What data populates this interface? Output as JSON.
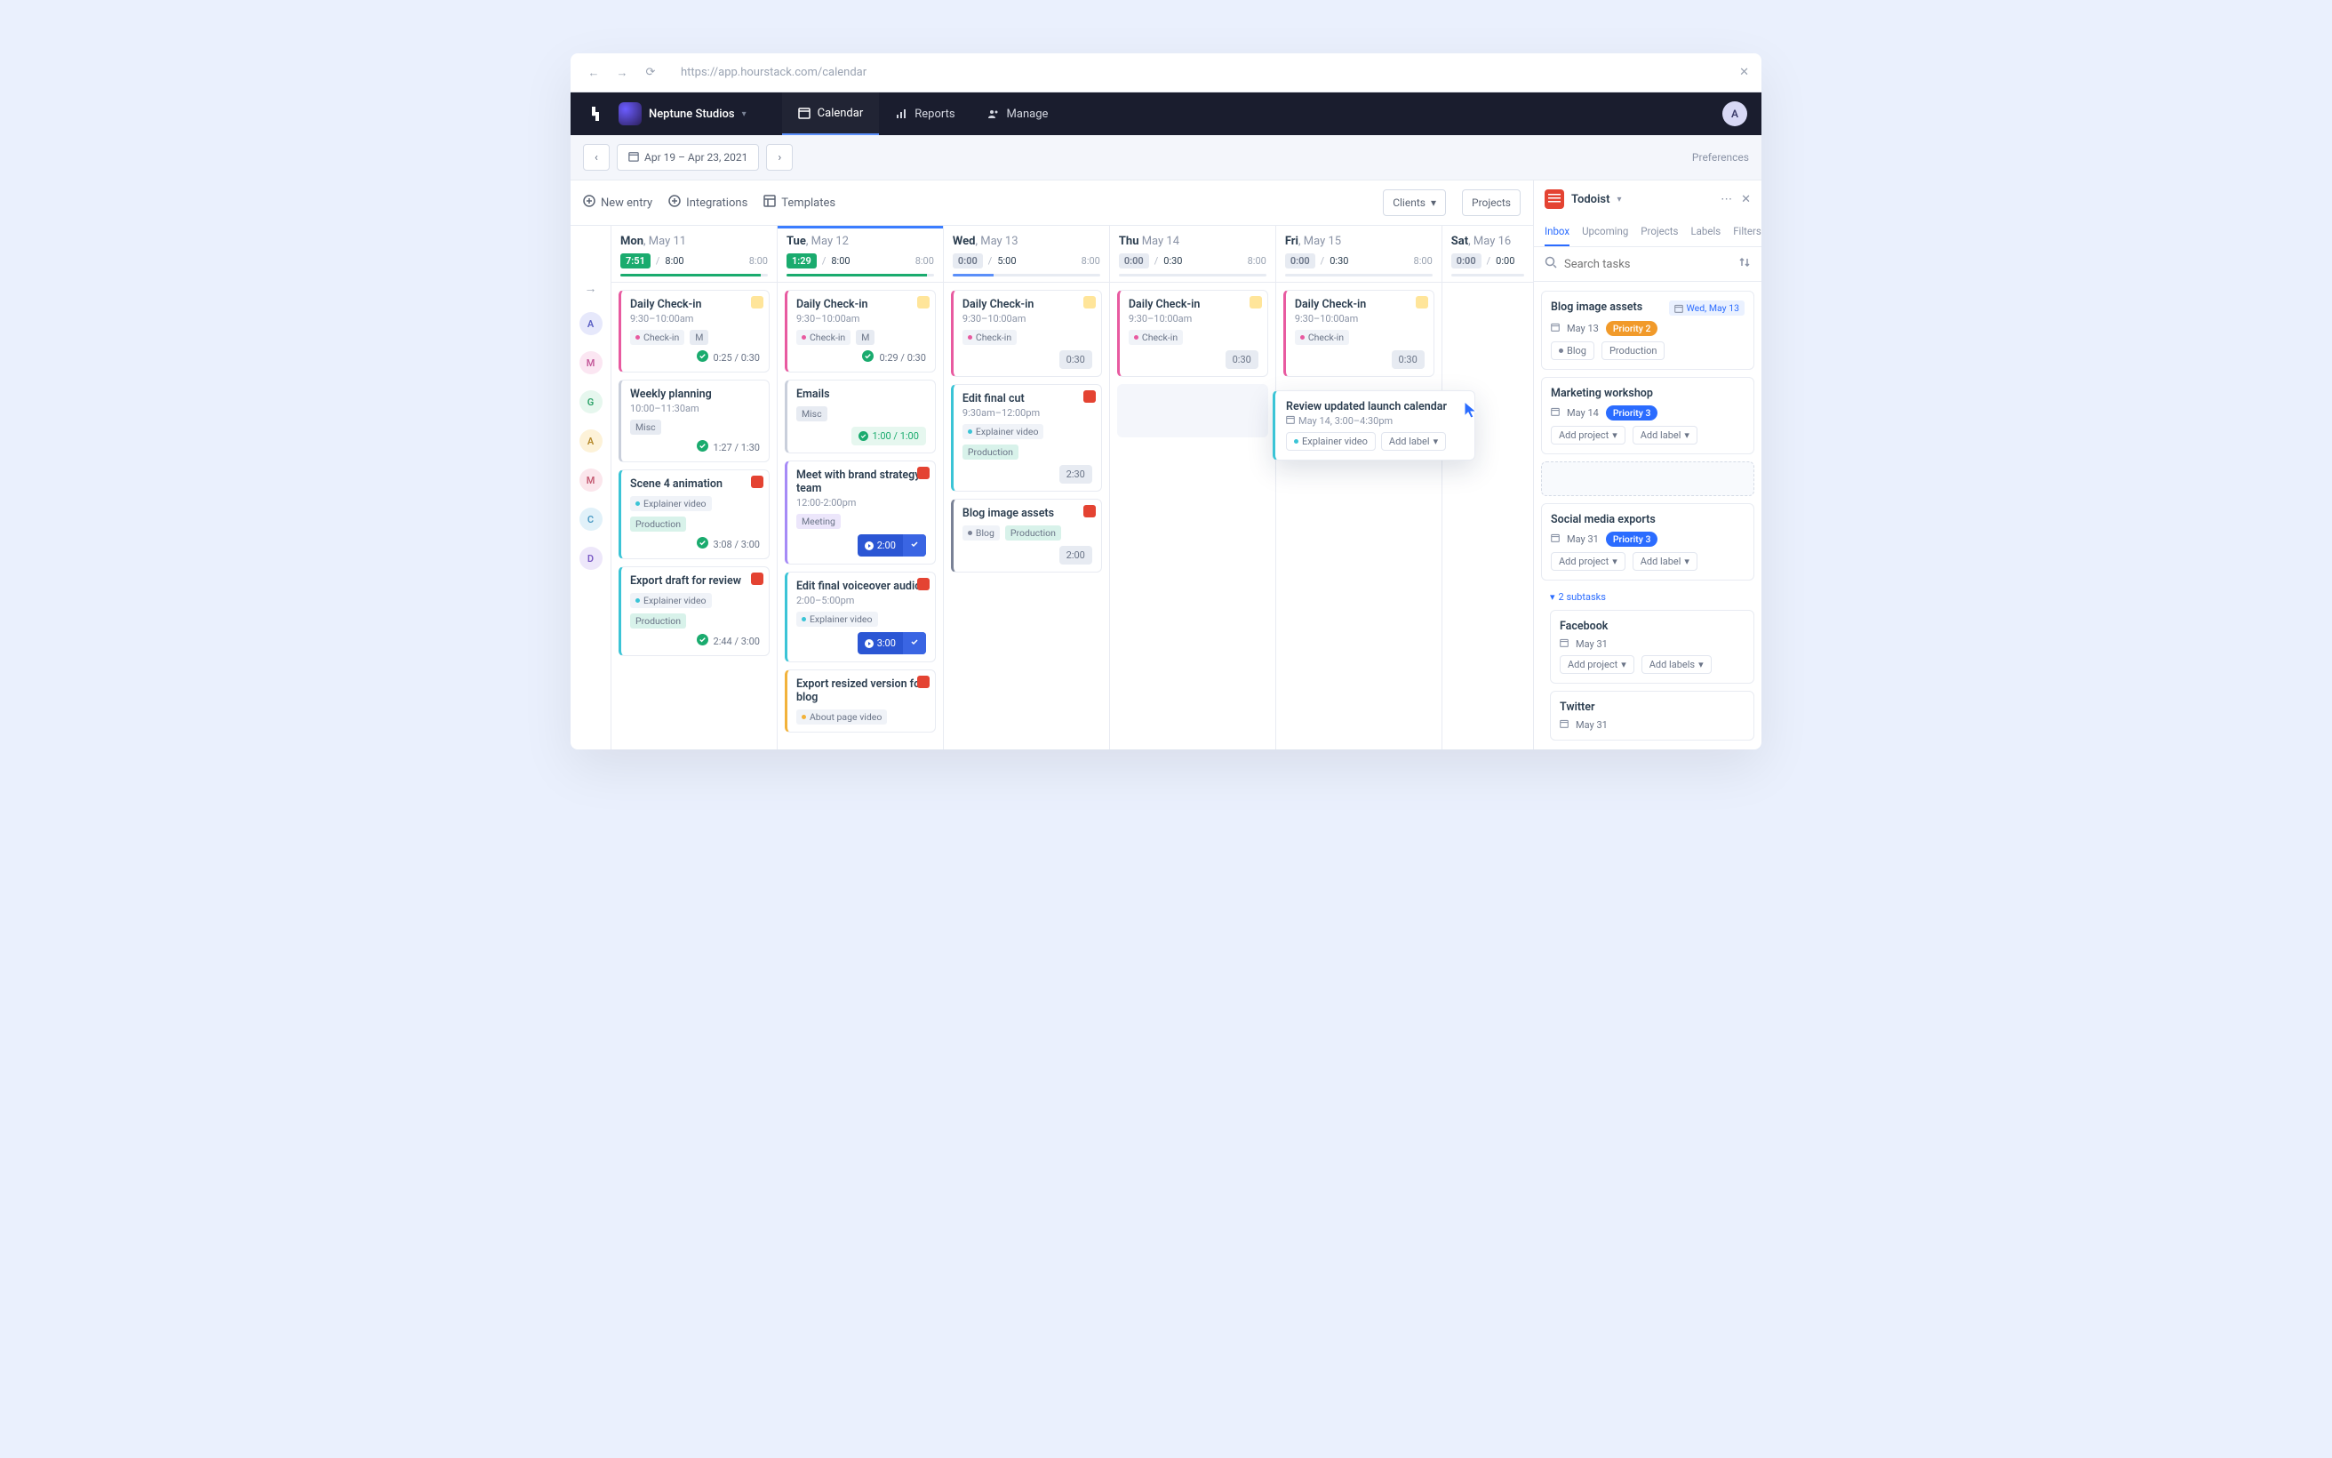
{
  "browser": {
    "url": "https://app.hourstack.com/calendar"
  },
  "topnav": {
    "workspace": "Neptune Studios",
    "items": [
      "Calendar",
      "Reports",
      "Manage"
    ],
    "avatar": "A"
  },
  "subbar": {
    "date_range": "Apr 19 – Apr 23, 2021",
    "preferences": "Preferences"
  },
  "toolbar": {
    "new_entry": "New entry",
    "integrations": "Integrations",
    "templates": "Templates",
    "clients": "Clients",
    "projects": "Projects"
  },
  "rail_users": [
    {
      "initial": "A",
      "bg": "#e6e8fb",
      "fg": "#5a5fc4"
    },
    {
      "initial": "M",
      "bg": "#fbe6f2",
      "fg": "#c45a9a"
    },
    {
      "initial": "G",
      "bg": "#e6f7ee",
      "fg": "#2fa36b"
    },
    {
      "initial": "A",
      "bg": "#fdf2d8",
      "fg": "#b5892b"
    },
    {
      "initial": "M",
      "bg": "#fbe6ec",
      "fg": "#c45a72"
    },
    {
      "initial": "C",
      "bg": "#e1f1f9",
      "fg": "#4a9ac4"
    },
    {
      "initial": "D",
      "bg": "#ede7fa",
      "fg": "#7a5ac4"
    }
  ],
  "columns": [
    {
      "day_short": "Mon",
      "day_rest": ", May 11",
      "badge": "7:51",
      "badge_class": "green",
      "planned": "8:00",
      "alt": "8:00",
      "bar": "bar-green",
      "cards": [
        {
          "accent": "#e85aa0",
          "title": "Daily Check-in",
          "sub": "9:30–10:00am",
          "badgeColor": "#ffe59a",
          "chips": [
            {
              "dot": "#e85aa0",
              "label": "Check-in"
            },
            {
              "label": "M",
              "bg": "#e7ebf2"
            }
          ],
          "foot": {
            "type": "done",
            "text": "0:25 / 0:30"
          }
        },
        {
          "accent": "#c9cfdb",
          "title": "Weekly planning",
          "sub": "10:00–11:30am",
          "chips": [
            {
              "label": "Misc",
              "bg": "#e7ebf2"
            }
          ],
          "foot": {
            "type": "done",
            "text": "1:27 / 1:30"
          }
        },
        {
          "accent": "#3bc4d6",
          "title": "Scene 4 animation",
          "badgeColor": "#e44332",
          "chips": [
            {
              "dot": "#3bc4d6",
              "label": "Explainer video"
            },
            {
              "label": "Production",
              "bg": "#d8f2ea"
            }
          ],
          "foot": {
            "type": "done",
            "text": "3:08 / 3:00"
          }
        },
        {
          "accent": "#3bc4d6",
          "title": "Export draft for review",
          "badgeColor": "#e44332",
          "chips": [
            {
              "dot": "#3bc4d6",
              "label": "Explainer video"
            },
            {
              "label": "Production",
              "bg": "#d8f2ea"
            }
          ],
          "foot": {
            "type": "done",
            "text": "2:44 / 3:00"
          }
        }
      ]
    },
    {
      "day_short": "Tue",
      "day_rest": ", May 12",
      "active": true,
      "badge": "1:29",
      "badge_class": "green",
      "planned": "8:00",
      "alt": "8:00",
      "bar": "bar-green",
      "cards": [
        {
          "accent": "#e85aa0",
          "title": "Daily Check-in",
          "sub": "9:30–10:00am",
          "badgeColor": "#ffe59a",
          "chips": [
            {
              "dot": "#e85aa0",
              "label": "Check-in"
            },
            {
              "label": "M",
              "bg": "#e7ebf2"
            }
          ],
          "foot": {
            "type": "done",
            "text": "0:29 / 0:30"
          }
        },
        {
          "accent": "#c9cfdb",
          "title": "Emails",
          "chips": [
            {
              "label": "Misc",
              "bg": "#e7ebf2"
            }
          ],
          "foot": {
            "type": "greenpill",
            "text": "1:00 / 1:00"
          }
        },
        {
          "accent": "#a68af6",
          "title": "Meet with brand strategy team",
          "sub": "12:00-2:00pm",
          "badgeColor": "#e44332",
          "chips": [
            {
              "label": "Meeting",
              "bg": "#ece6fb"
            }
          ],
          "foot": {
            "type": "play",
            "text": "2:00"
          }
        },
        {
          "accent": "#3bc4d6",
          "title": "Edit final voiceover audio",
          "sub": "2:00–5:00pm",
          "badgeColor": "#e44332",
          "chips": [
            {
              "dot": "#3bc4d6",
              "label": "Explainer video"
            }
          ],
          "foot": {
            "type": "play",
            "text": "3:00"
          }
        },
        {
          "accent": "#f2b23a",
          "title": "Export resized version for blog",
          "badgeColor": "#e44332",
          "chips": [
            {
              "dot": "#f2b23a",
              "label": "About page video"
            }
          ]
        }
      ]
    },
    {
      "day_short": "Wed",
      "day_rest": ", May 13",
      "badge": "0:00",
      "badge_class": "grey",
      "planned": "5:00",
      "alt": "8:00",
      "bar": "bar-blue",
      "cards": [
        {
          "accent": "#e85aa0",
          "title": "Daily Check-in",
          "sub": "9:30–10:00am",
          "badgeColor": "#ffe59a",
          "chips": [
            {
              "dot": "#e85aa0",
              "label": "Check-in"
            }
          ],
          "foot": {
            "type": "chip",
            "text": "0:30"
          }
        },
        {
          "accent": "#3bc4d6",
          "title": "Edit final cut",
          "sub": "9:30am–12:00pm",
          "badgeColor": "#e44332",
          "chips": [
            {
              "dot": "#3bc4d6",
              "label": "Explainer video"
            },
            {
              "label": "Production",
              "bg": "#d8f2ea"
            }
          ],
          "foot": {
            "type": "chip",
            "text": "2:30"
          }
        },
        {
          "accent": "#7a8296",
          "title": "Blog image assets",
          "badgeColor": "#e44332",
          "chips": [
            {
              "dot": "#7a8296",
              "label": "Blog"
            },
            {
              "label": "Production",
              "bg": "#d8f2ea"
            }
          ],
          "foot": {
            "type": "chip",
            "text": "2:00"
          }
        }
      ]
    },
    {
      "day_short": "Thu",
      "day_rest": " May 14",
      "badge": "0:00",
      "badge_class": "grey",
      "planned": "0:30",
      "alt": "8:00",
      "bar": "bar-grey",
      "cards": [
        {
          "accent": "#e85aa0",
          "title": "Daily Check-in",
          "sub": "9:30–10:00am",
          "badgeColor": "#ffe59a",
          "chips": [
            {
              "dot": "#e85aa0",
              "label": "Check-in"
            }
          ],
          "foot": {
            "type": "chip",
            "text": "0:30"
          }
        },
        {
          "placeholder": true
        }
      ]
    },
    {
      "day_short": "Fri",
      "day_rest": ", May 15",
      "badge": "0:00",
      "badge_class": "grey",
      "planned": "0:30",
      "alt": "8:00",
      "bar": "bar-grey",
      "cards": [
        {
          "accent": "#e85aa0",
          "title": "Daily Check-in",
          "sub": "9:30–10:00am",
          "badgeColor": "#ffe59a",
          "chips": [
            {
              "dot": "#e85aa0",
              "label": "Check-in"
            }
          ],
          "foot": {
            "type": "chip",
            "text": "0:30"
          }
        }
      ]
    },
    {
      "day_short": "Sat",
      "day_rest": ", May 16",
      "badge": "0:00",
      "badge_class": "grey",
      "planned": "0:00",
      "bar": "bar-grey",
      "cards": []
    }
  ],
  "dragged": {
    "title": "Review updated launch calendar",
    "sub": "May 14, 3:00–4:30pm",
    "chip_label": "Explainer video",
    "chip_dot": "#3bc4d6",
    "add_label": "Add label"
  },
  "todoist": {
    "title": "Todoist",
    "tabs": [
      "Inbox",
      "Upcoming",
      "Projects",
      "Labels",
      "Filters"
    ],
    "search_placeholder": "Search tasks",
    "tasks": [
      {
        "title": "Blog image assets",
        "date": "May 13",
        "priority": "Priority 2",
        "priority_class": "p2",
        "due": "Wed, May 13",
        "chips": [
          {
            "dot": "#7a8296",
            "label": "Blog"
          },
          {
            "label": "Production"
          }
        ]
      },
      {
        "title": "Marketing workshop",
        "date": "May 14",
        "priority": "Priority 3",
        "priority_class": "p3",
        "actions": [
          "Add project",
          "Add label"
        ],
        "placeholder_after": true
      },
      {
        "title": "Social media exports",
        "date": "May 31",
        "priority": "Priority 3",
        "priority_class": "p3",
        "actions": [
          "Add project",
          "Add label"
        ],
        "subtasks_label": "2 subtasks",
        "subs": [
          {
            "title": "Facebook",
            "date": "May 31",
            "actions": [
              "Add project",
              "Add labels"
            ]
          },
          {
            "title": "Twitter",
            "date": "May 31"
          }
        ]
      }
    ]
  }
}
